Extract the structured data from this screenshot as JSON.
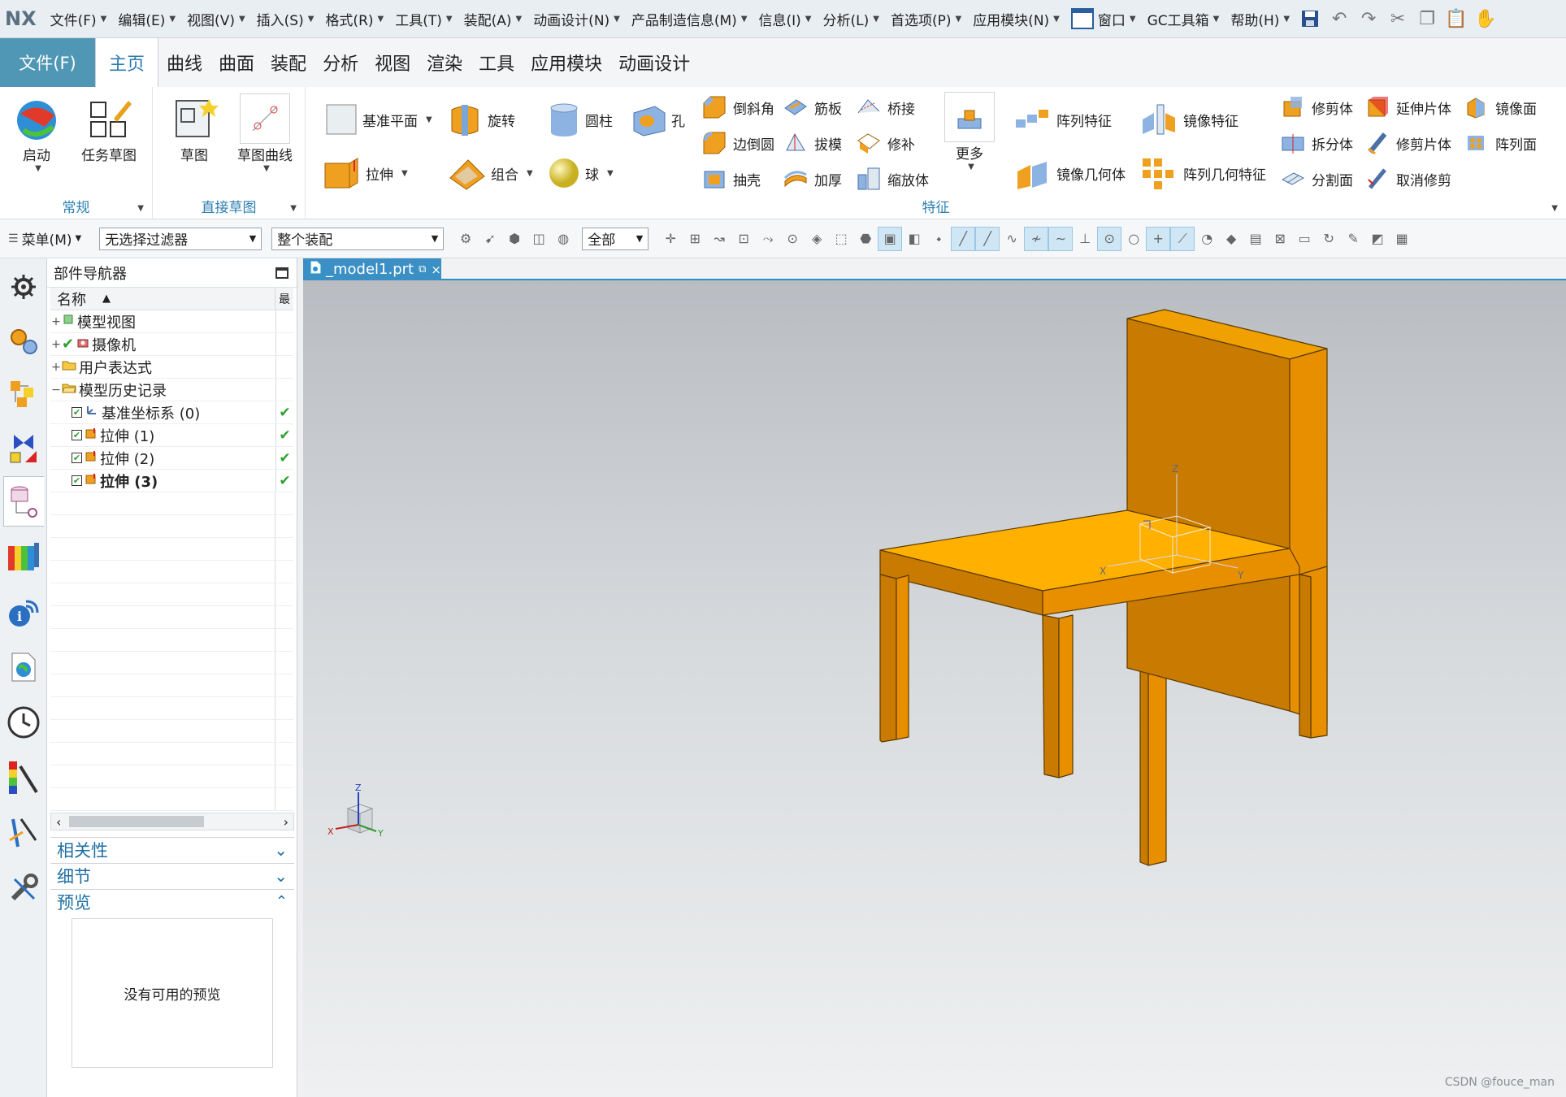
{
  "menubar": {
    "logo": "NX",
    "items": [
      "文件(F)",
      "编辑(E)",
      "视图(V)",
      "插入(S)",
      "格式(R)",
      "工具(T)",
      "装配(A)",
      "动画设计(N)",
      "产品制造信息(M)",
      "信息(I)",
      "分析(L)",
      "首选项(P)",
      "应用模块(N)",
      "窗口",
      "GC工具箱",
      "帮助(H)"
    ]
  },
  "tabs": {
    "file": "文件(F)",
    "items": [
      "主页",
      "曲线",
      "曲面",
      "装配",
      "分析",
      "视图",
      "渲染",
      "工具",
      "应用模块",
      "动画设计"
    ],
    "active_index": 0
  },
  "ribbon": {
    "groups": {
      "general": "常规",
      "direct_sketch": "直接草图",
      "feature": "特征"
    },
    "buttons": {
      "start": "启动",
      "task_sketch": "任务草图",
      "sketch": "草图",
      "sketch_curve": "草图曲线",
      "datum_plane": "基准平面",
      "extrude": "拉伸",
      "revolve": "旋转",
      "combine": "组合",
      "cylinder": "圆柱",
      "sphere": "球",
      "hole": "孔",
      "chamfer": "倒斜角",
      "edge_blend": "边倒圆",
      "shell": "抽壳",
      "rib": "筋板",
      "draft": "拔模",
      "thicken": "加厚",
      "bridge": "桥接",
      "patch": "修补",
      "scale_body": "缩放体",
      "more": "更多",
      "pattern_feature": "阵列特征",
      "mirror_geometry": "镜像几何体",
      "mirror_feature": "镜像特征",
      "pattern_geometry": "阵列几何特征",
      "trim_body": "修剪体",
      "split_body": "拆分体",
      "divide_face": "分割面",
      "extend_sheet": "延伸片体",
      "trim_sheet": "修剪片体",
      "untrim": "取消修剪",
      "mirror_face": "镜像面",
      "pattern_face": "阵列面"
    }
  },
  "selbar": {
    "menu_label": "菜单(M)",
    "filter": "无选择过滤器",
    "scope": "整个装配",
    "all": "全部"
  },
  "navigator": {
    "title": "部件导航器",
    "col_name": "名称",
    "col_latest": "最",
    "items": [
      {
        "label": "模型视图",
        "expander": "+",
        "status": ""
      },
      {
        "label": "摄像机",
        "expander": "+",
        "status": ""
      },
      {
        "label": "用户表达式",
        "expander": "+",
        "status": ""
      },
      {
        "label": "模型历史记录",
        "expander": "−",
        "status": ""
      },
      {
        "label": "基准坐标系 (0)",
        "expander": "",
        "status": "✔"
      },
      {
        "label": "拉伸 (1)",
        "expander": "",
        "status": "✔"
      },
      {
        "label": "拉伸 (2)",
        "expander": "",
        "status": "✔"
      },
      {
        "label": "拉伸 (3)",
        "expander": "",
        "status": "✔"
      }
    ],
    "panels": {
      "dependencies": "相关性",
      "details": "细节",
      "preview": "预览",
      "no_preview": "没有可用的预览"
    }
  },
  "document": {
    "tab_title": "_model1.prt"
  },
  "viewport": {
    "triad_labels": {
      "x": "X",
      "y": "Y",
      "z": "Z"
    },
    "watermark": "CSDN @fouce_man"
  },
  "colors": {
    "accent": "#2b7bb0",
    "file_tab": "#4f97b4",
    "model_top": "#ffb000",
    "model_side": "#e88f00",
    "model_edge": "#5a3a00"
  }
}
